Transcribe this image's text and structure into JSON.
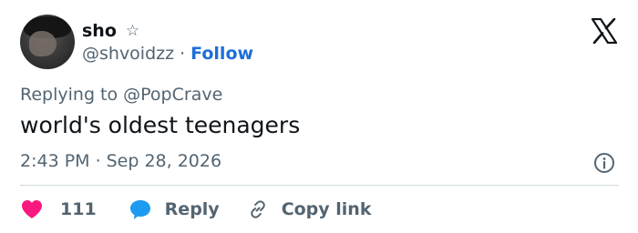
{
  "author": {
    "display_name": "sho",
    "badge_icon": "star-icon",
    "handle": "@shvoidzz",
    "separator": "·",
    "follow_label": "Follow"
  },
  "reply_context": "Replying to @PopCrave",
  "tweet": {
    "text": "world's oldest teenagers",
    "time": "2:43 PM",
    "separator": "·",
    "date": "Sep 28, 2026"
  },
  "actions": {
    "like_count": "111",
    "reply_label": "Reply",
    "copy_label": "Copy link"
  },
  "colors": {
    "like": "#f91880",
    "reply": "#1d9bf0",
    "link": "#1d6fd9",
    "secondary_text": "#536471"
  }
}
